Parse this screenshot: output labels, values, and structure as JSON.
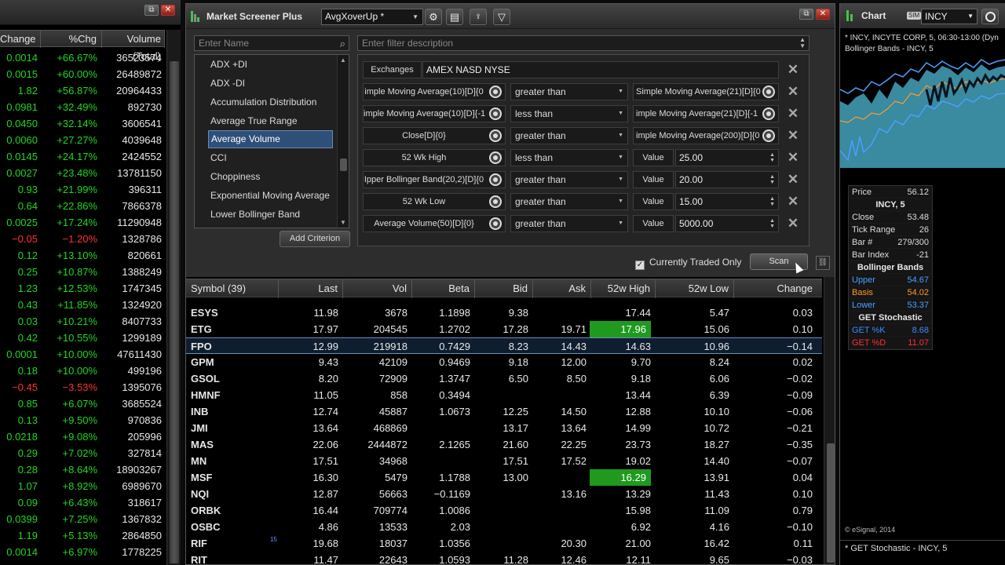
{
  "left_panel": {
    "columns": [
      "Change",
      "%Chg",
      "Volume (Total)"
    ],
    "window_buttons": [
      "⧉",
      "✕"
    ],
    "rows": [
      {
        "change": "0.0014",
        "pct": "+66.67%",
        "vol": "36523574",
        "dir": "pos"
      },
      {
        "change": "0.0015",
        "pct": "+60.00%",
        "vol": "26489872",
        "dir": "pos"
      },
      {
        "change": "1.82",
        "pct": "+56.87%",
        "vol": "20964433",
        "dir": "pos"
      },
      {
        "change": "0.0981",
        "pct": "+32.49%",
        "vol": "892730",
        "dir": "pos"
      },
      {
        "change": "0.0450",
        "pct": "+32.14%",
        "vol": "3606541",
        "dir": "pos"
      },
      {
        "change": "0.0060",
        "pct": "+27.27%",
        "vol": "4039648",
        "dir": "pos"
      },
      {
        "change": "0.0145",
        "pct": "+24.17%",
        "vol": "2424552",
        "dir": "pos"
      },
      {
        "change": "0.0027",
        "pct": "+23.48%",
        "vol": "13781150",
        "dir": "pos"
      },
      {
        "change": "0.93",
        "pct": "+21.99%",
        "vol": "396311",
        "dir": "pos"
      },
      {
        "change": "0.64",
        "pct": "+22.86%",
        "vol": "7866378",
        "dir": "pos"
      },
      {
        "change": "0.0025",
        "pct": "+17.24%",
        "vol": "11290948",
        "dir": "pos"
      },
      {
        "change": "−0.05",
        "pct": "−1.20%",
        "vol": "1328786",
        "dir": "neg"
      },
      {
        "change": "0.12",
        "pct": "+13.10%",
        "vol": "820661",
        "dir": "pos"
      },
      {
        "change": "0.25",
        "pct": "+10.87%",
        "vol": "1388249",
        "dir": "pos"
      },
      {
        "change": "1.23",
        "pct": "+12.53%",
        "vol": "1747345",
        "dir": "pos"
      },
      {
        "change": "0.43",
        "pct": "+11.85%",
        "vol": "1324920",
        "dir": "pos"
      },
      {
        "change": "0.03",
        "pct": "+10.21%",
        "vol": "8407733",
        "dir": "pos"
      },
      {
        "change": "0.42",
        "pct": "+10.55%",
        "vol": "1299189",
        "dir": "pos"
      },
      {
        "change": "0.0001",
        "pct": "+10.00%",
        "vol": "47611430",
        "dir": "pos"
      },
      {
        "change": "0.18",
        "pct": "+10.00%",
        "vol": "499196",
        "dir": "pos"
      },
      {
        "change": "−0.45",
        "pct": "−3.53%",
        "vol": "1395076",
        "dir": "neg"
      },
      {
        "change": "0.85",
        "pct": "+6.07%",
        "vol": "3685524",
        "dir": "pos"
      },
      {
        "change": "0.13",
        "pct": "+9.50%",
        "vol": "970836",
        "dir": "pos"
      },
      {
        "change": "0.0218",
        "pct": "+9.08%",
        "vol": "205996",
        "dir": "pos"
      },
      {
        "change": "0.29",
        "pct": "+7.02%",
        "vol": "327814",
        "dir": "pos"
      },
      {
        "change": "0.28",
        "pct": "+8.64%",
        "vol": "18903267",
        "dir": "pos"
      },
      {
        "change": "1.07",
        "pct": "+8.92%",
        "vol": "6989670",
        "dir": "pos"
      },
      {
        "change": "0.09",
        "pct": "+6.43%",
        "vol": "318617",
        "dir": "pos"
      },
      {
        "change": "0.0399",
        "pct": "+7.25%",
        "vol": "1367832",
        "dir": "pos"
      },
      {
        "change": "1.19",
        "pct": "+5.13%",
        "vol": "2864850",
        "dir": "pos"
      },
      {
        "change": "0.0014",
        "pct": "+6.97%",
        "vol": "1778225",
        "dir": "pos"
      }
    ]
  },
  "screener": {
    "title": "Market Screener Plus",
    "preset": "AvgXoverUp *",
    "name_placeholder": "Enter Name",
    "filter_placeholder": "Enter filter description",
    "indicators": [
      "ADX +DI",
      "ADX -DI",
      "Accumulation Distribution",
      "Average True Range",
      "Average Volume",
      "CCI",
      "Choppiness",
      "Exponential Moving Average",
      "Lower Bollinger Band"
    ],
    "selected_indicator": "Average Volume",
    "add_criterion": "Add Criterion",
    "exchanges_label": "Exchanges",
    "exchanges_value": "AMEX NASD NYSE",
    "value_label": "Value",
    "criteria": [
      {
        "left": "imple Moving Average(10)[D]{0",
        "op": "greater than",
        "right": "Simple Moving Average(21)[D]{0",
        "kind": "study"
      },
      {
        "left": "imple Moving Average(10)[D]{-1",
        "op": "less than",
        "right": "imple Moving Average(21)[D]{-1",
        "kind": "study"
      },
      {
        "left": "Close[D]{0}",
        "op": "greater than",
        "right": "imple Moving Average(200)[D]{0",
        "kind": "study"
      },
      {
        "left": "52 Wk High",
        "op": "less than",
        "right": "25.00",
        "kind": "value"
      },
      {
        "left": "Ipper Bollinger Band(20,2)[D]{0",
        "op": "greater than",
        "right": "20.00",
        "kind": "value"
      },
      {
        "left": "52 Wk Low",
        "op": "greater than",
        "right": "15.00",
        "kind": "value"
      },
      {
        "left": "Average Volume(50)[D]{0}",
        "op": "greater than",
        "right": "5000.00",
        "kind": "value"
      }
    ],
    "currently_traded_only": "Currently Traded Only",
    "scan": "Scan",
    "columns": [
      "Symbol (39)",
      "Last",
      "Vol",
      "Beta",
      "Bid",
      "Ask",
      "52w High",
      "52w Low",
      "Change"
    ],
    "rows": [
      {
        "sym": "ESYS",
        "last": "11.98",
        "vol": "3678",
        "beta": "1.1898",
        "bid": "9.38",
        "ask": "",
        "hi": "17.44",
        "lo": "5.47",
        "chg": "0.03",
        "dir": "pos",
        "hl": false,
        "sel": false
      },
      {
        "sym": "ETG",
        "last": "17.97",
        "vol": "204545",
        "beta": "1.2702",
        "bid": "17.28",
        "ask": "19.71",
        "hi": "17.96",
        "lo": "15.06",
        "chg": "0.10",
        "dir": "pos",
        "hl": true,
        "sel": false
      },
      {
        "sym": "FPO",
        "last": "12.99",
        "vol": "219918",
        "beta": "0.7429",
        "bid": "8.23",
        "ask": "14.43",
        "hi": "14.63",
        "lo": "10.96",
        "chg": "−0.14",
        "dir": "neg",
        "hl": false,
        "sel": true
      },
      {
        "sym": "GPM",
        "last": "9.43",
        "vol": "42109",
        "beta": "0.9469",
        "bid": "9.18",
        "ask": "12.00",
        "hi": "9.70",
        "lo": "8.24",
        "chg": "0.02",
        "dir": "pos",
        "hl": false,
        "sel": false
      },
      {
        "sym": "GSOL",
        "last": "8.20",
        "vol": "72909",
        "beta": "1.3747",
        "bid": "6.50",
        "ask": "8.50",
        "hi": "9.18",
        "lo": "6.06",
        "chg": "−0.02",
        "dir": "neg",
        "hl": false,
        "sel": false
      },
      {
        "sym": "HMNF",
        "last": "11.05",
        "vol": "858",
        "beta": "0.3494",
        "bid": "",
        "ask": "",
        "hi": "13.44",
        "lo": "6.39",
        "chg": "−0.09",
        "dir": "neg",
        "hl": false,
        "sel": false
      },
      {
        "sym": "INB",
        "last": "12.74",
        "vol": "45887",
        "beta": "1.0673",
        "bid": "12.25",
        "ask": "14.50",
        "hi": "12.88",
        "lo": "10.10",
        "chg": "−0.06",
        "dir": "neg",
        "hl": false,
        "sel": false
      },
      {
        "sym": "JMI",
        "last": "13.64",
        "vol": "468869",
        "beta": "",
        "bid": "13.17",
        "ask": "13.64",
        "hi": "14.99",
        "lo": "10.72",
        "chg": "−0.21",
        "dir": "neg",
        "hl": false,
        "sel": false
      },
      {
        "sym": "MAS",
        "last": "22.06",
        "vol": "2444872",
        "beta": "2.1265",
        "bid": "21.60",
        "ask": "22.25",
        "hi": "23.73",
        "lo": "18.27",
        "chg": "−0.35",
        "dir": "neg",
        "hl": false,
        "sel": false
      },
      {
        "sym": "MN",
        "last": "17.51",
        "vol": "34968",
        "beta": "",
        "bid": "17.51",
        "ask": "17.52",
        "hi": "19.02",
        "lo": "14.40",
        "chg": "−0.07",
        "dir": "neg",
        "hl": false,
        "sel": false
      },
      {
        "sym": "MSF",
        "last": "16.30",
        "vol": "5479",
        "beta": "1.1788",
        "bid": "13.00",
        "ask": "",
        "hi": "16.29",
        "lo": "13.91",
        "chg": "0.04",
        "dir": "pos",
        "hl": true,
        "sel": false
      },
      {
        "sym": "NQI",
        "last": "12.87",
        "vol": "56663",
        "beta": "−0.1169",
        "bid": "",
        "ask": "13.16",
        "hi": "13.29",
        "lo": "11.43",
        "chg": "0.10",
        "dir": "pos",
        "hl": false,
        "sel": false
      },
      {
        "sym": "ORBK",
        "last": "16.44",
        "vol": "709774",
        "beta": "1.0086",
        "bid": "",
        "ask": "",
        "hi": "15.98",
        "lo": "11.09",
        "chg": "0.79",
        "dir": "pos",
        "hl": false,
        "sel": false
      },
      {
        "sym": "OSBC",
        "last": "4.86",
        "vol": "13533",
        "beta": "2.03",
        "bid": "",
        "ask": "",
        "hi": "6.92",
        "lo": "4.16",
        "chg": "−0.10",
        "dir": "neg",
        "hl": false,
        "sel": false
      },
      {
        "sym": "RIF",
        "last": "19.68",
        "vol": "18037",
        "beta": "1.0356",
        "bid": "",
        "ask": "20.30",
        "hi": "21.00",
        "lo": "16.42",
        "chg": "0.11",
        "dir": "pos",
        "hl": false,
        "sel": false,
        "note": "15"
      },
      {
        "sym": "RIT",
        "last": "11.47",
        "vol": "22643",
        "beta": "1.0593",
        "bid": "11.28",
        "ask": "12.46",
        "hi": "12.11",
        "lo": "9.65",
        "chg": "−0.03",
        "dir": "neg",
        "hl": false,
        "sel": false
      }
    ]
  },
  "chart": {
    "title": "Chart",
    "sim_badge": "SIM",
    "symbol": "INCY",
    "desc_line1": "* INCY, INCYTE CORP, 5, 06:30-13:00 (Dyn",
    "desc_line2": "Bollinger Bands - INCY, 5",
    "data_window": {
      "price_label": "Price",
      "price": "56.12",
      "symbol_title": "INCY, 5",
      "close_label": "Close",
      "close": "53.48",
      "tick_label": "Tick Range",
      "tick": "26",
      "bar_label": "Bar #",
      "bar": "279/300",
      "barindex_label": "Bar Index",
      "barindex": "-21",
      "bb_title": "Bollinger Bands",
      "upper_label": "Upper",
      "upper": "54.67",
      "basis_label": "Basis",
      "basis": "54.02",
      "lower_label": "Lower",
      "lower": "53.37",
      "stoch_title": "GET Stochastic",
      "k_label": "GET %K",
      "k": "8.68",
      "d_label": "GET %D",
      "d": "11.07"
    },
    "copyright": "© eSignal, 2014",
    "footer": "* GET Stochastic - INCY, 5"
  },
  "colors": {
    "positive": "#22d622",
    "negative": "#ff3030",
    "highlight": "#1f9a1f",
    "upper_band": "#4aa0ff",
    "basis_band": "#ff9a2e",
    "lower_band": "#4aa0ff",
    "stoch_k": "#3a8cff",
    "stoch_d": "#ff3030"
  }
}
